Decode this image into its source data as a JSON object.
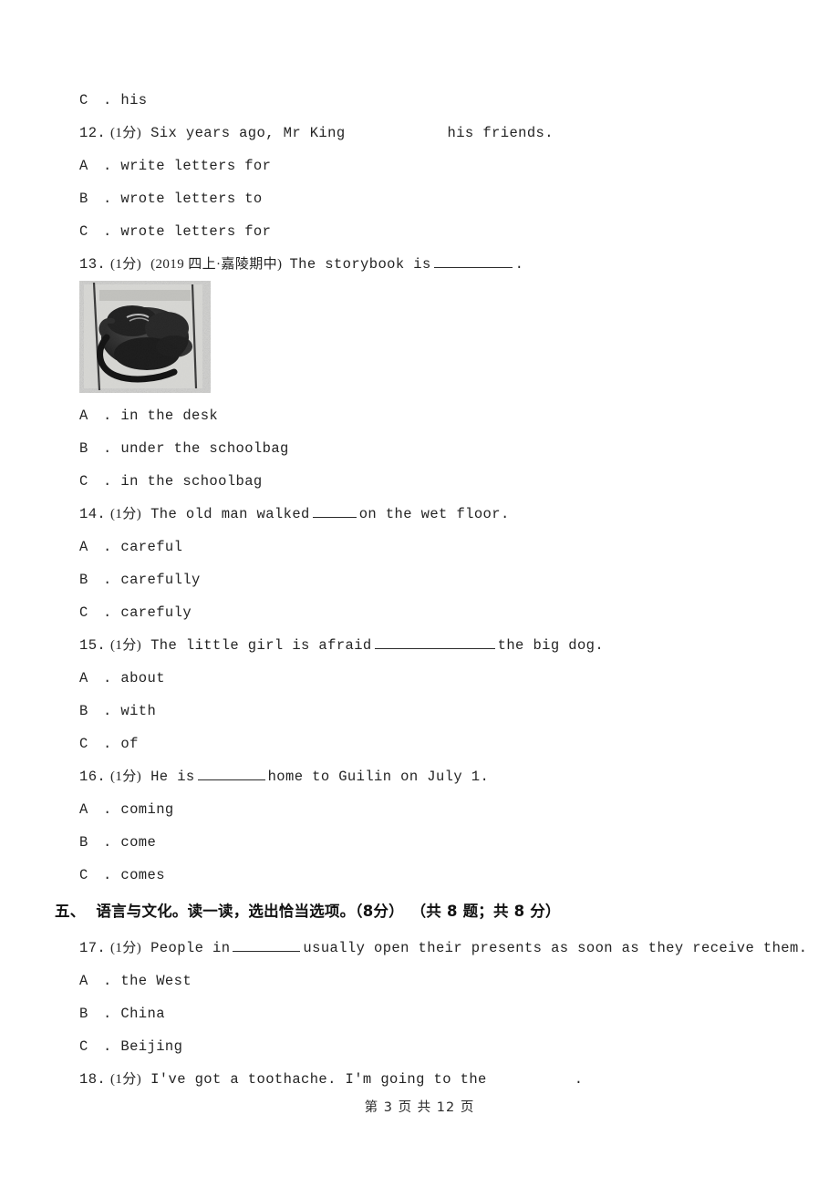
{
  "document": {
    "type": "scanned-exam-paper",
    "language": "en-zh"
  },
  "orphan_option": {
    "letter": "C",
    "separator": ".",
    "text": "his"
  },
  "questions": [
    {
      "number": "12.",
      "marks": "(1分)",
      "source_tag": "",
      "stem_before": "Six years ago, Mr King",
      "blank": "gap-m",
      "stem_after": "his friends.",
      "options": [
        {
          "letter": "A",
          "separator": ".",
          "text": "write letters for"
        },
        {
          "letter": "B",
          "separator": ".",
          "text": "wrote letters to"
        },
        {
          "letter": "C",
          "separator": ".",
          "text": "wrote letters for"
        }
      ]
    },
    {
      "number": "13.",
      "marks": "(1分)",
      "source_tag": "(2019 四上·嘉陵期中)",
      "stem_before": "The storybook is",
      "blank": "underline-m",
      "stem_after": ".",
      "figure": {
        "alt": "black-schoolbag-photo",
        "caption": ""
      },
      "options": [
        {
          "letter": "A",
          "separator": ".",
          "text": "in the desk"
        },
        {
          "letter": "B",
          "separator": ".",
          "text": "under the schoolbag"
        },
        {
          "letter": "C",
          "separator": ".",
          "text": "in the schoolbag"
        }
      ]
    },
    {
      "number": "14.",
      "marks": "(1分)",
      "source_tag": "",
      "stem_before": "The old man walked",
      "blank": "underline-xs",
      "stem_after": "on the wet floor.",
      "options": [
        {
          "letter": "A",
          "separator": ".",
          "text": "careful"
        },
        {
          "letter": "B",
          "separator": ".",
          "text": "carefully"
        },
        {
          "letter": "C",
          "separator": ".",
          "text": "carefuly"
        }
      ]
    },
    {
      "number": "15.",
      "marks": "(1分)",
      "source_tag": "",
      "stem_before": "The little girl is afraid",
      "blank": "underline-l",
      "stem_after": "the big dog.",
      "options": [
        {
          "letter": "A",
          "separator": ".",
          "text": "about"
        },
        {
          "letter": "B",
          "separator": ".",
          "text": "with"
        },
        {
          "letter": "C",
          "separator": ".",
          "text": "of"
        }
      ]
    },
    {
      "number": "16.",
      "marks": "(1分)",
      "source_tag": "",
      "stem_before": "He is",
      "blank": "underline-s",
      "stem_after": "home to Guilin on July 1.",
      "options": [
        {
          "letter": "A",
          "separator": ".",
          "text": "coming"
        },
        {
          "letter": "B",
          "separator": ".",
          "text": "come"
        },
        {
          "letter": "C",
          "separator": ".",
          "text": "comes"
        }
      ]
    },
    {
      "number": "17.",
      "marks": "(1分)",
      "source_tag": "",
      "stem_before": "People in",
      "blank": "underline-s",
      "stem_after": "usually open their presents as soon as they receive them.",
      "options": [
        {
          "letter": "A",
          "separator": ".",
          "text": "the West"
        },
        {
          "letter": "B",
          "separator": ".",
          "text": "China"
        },
        {
          "letter": "C",
          "separator": ".",
          "text": "Beijing"
        }
      ]
    },
    {
      "number": "18.",
      "marks": "(1分)",
      "source_tag": "",
      "stem_before": "I've got a toothache. I'm going to the",
      "blank": "gap-s",
      "stem_after": ".",
      "options": []
    }
  ],
  "section": {
    "number": "五、",
    "title": "语言与文化。读一读，选出恰当选项。（8分）",
    "count": "（共 8 题；共 8 分）"
  },
  "footer": {
    "text": "第 3 页 共 12 页"
  }
}
